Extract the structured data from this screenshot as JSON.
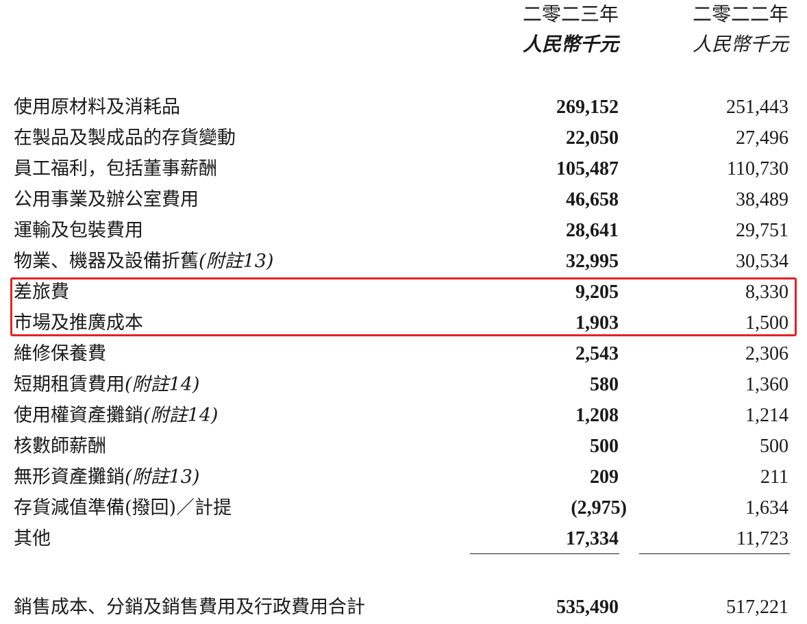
{
  "header": {
    "year_2023": "二零二三年",
    "unit_2023": "人民幣千元",
    "year_2022": "二零二二年",
    "unit_2022": "人民幣千元"
  },
  "rows": [
    {
      "label": "使用原材料及消耗品",
      "note": "",
      "v2023": "269,152",
      "v2022": "251,443"
    },
    {
      "label": "在製品及製成品的存貨變動",
      "note": "",
      "v2023": "22,050",
      "v2022": "27,496"
    },
    {
      "label": "員工福利，包括董事薪酬",
      "note": "",
      "v2023": "105,487",
      "v2022": "110,730"
    },
    {
      "label": "公用事業及辦公室費用",
      "note": "",
      "v2023": "46,658",
      "v2022": "38,489"
    },
    {
      "label": "運輸及包裝費用",
      "note": "",
      "v2023": "28,641",
      "v2022": "29,751"
    },
    {
      "label": "物業、機器及設備折舊",
      "note": "(附註13)",
      "v2023": "32,995",
      "v2022": "30,534"
    },
    {
      "label": "差旅費",
      "note": "",
      "v2023": "9,205",
      "v2022": "8,330"
    },
    {
      "label": "市場及推廣成本",
      "note": "",
      "v2023": "1,903",
      "v2022": "1,500"
    },
    {
      "label": "維修保養費",
      "note": "",
      "v2023": "2,543",
      "v2022": "2,306"
    },
    {
      "label": "短期租賃費用",
      "note": "(附註14)",
      "v2023": "580",
      "v2022": "1,360"
    },
    {
      "label": "使用權資產攤銷",
      "note": "(附註14)",
      "v2023": "1,208",
      "v2022": "1,214"
    },
    {
      "label": "核數師薪酬",
      "note": "",
      "v2023": "500",
      "v2022": "500"
    },
    {
      "label": "無形資產攤銷",
      "note": "(附註13)",
      "v2023": "209",
      "v2022": "211"
    },
    {
      "label": "存貨減值準備(撥回)／計提",
      "note": "",
      "v2023": "(2,975)",
      "v2022": "1,634"
    },
    {
      "label": "其他",
      "note": "",
      "v2023": "17,334",
      "v2022": "11,723"
    }
  ],
  "total": {
    "label": "銷售成本、分銷及銷售費用及行政費用合計",
    "v2023": "535,490",
    "v2022": "517,221"
  },
  "highlight_color": "#e52222"
}
